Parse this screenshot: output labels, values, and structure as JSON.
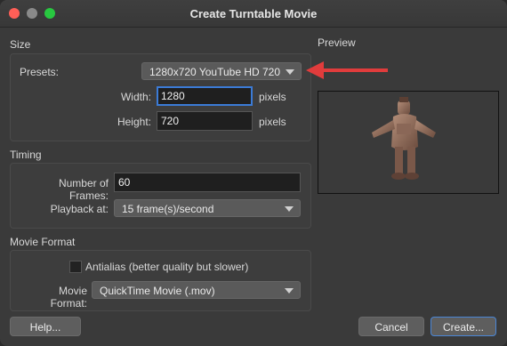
{
  "window": {
    "title": "Create Turntable Movie"
  },
  "size": {
    "section_title": "Size",
    "presets_label": "Presets:",
    "presets_value": "1280x720 YouTube HD 720",
    "width_label": "Width:",
    "width_value": "1280",
    "height_label": "Height:",
    "height_value": "720",
    "unit": "pixels"
  },
  "preview": {
    "title": "Preview"
  },
  "timing": {
    "section_title": "Timing",
    "frames_label": "Number of Frames:",
    "frames_value": "60",
    "playback_label": "Playback at:",
    "playback_value": "15 frame(s)/second"
  },
  "movie_format": {
    "section_title": "Movie Format",
    "antialias_label": "Antialias (better quality but slower)",
    "antialias_checked": false,
    "format_label": "Movie Format:",
    "format_value": "QuickTime Movie (.mov)"
  },
  "buttons": {
    "help": "Help...",
    "cancel": "Cancel",
    "create": "Create..."
  },
  "colors": {
    "annotation_arrow": "#e03c3c",
    "focus_ring": "#3b7bd6"
  }
}
